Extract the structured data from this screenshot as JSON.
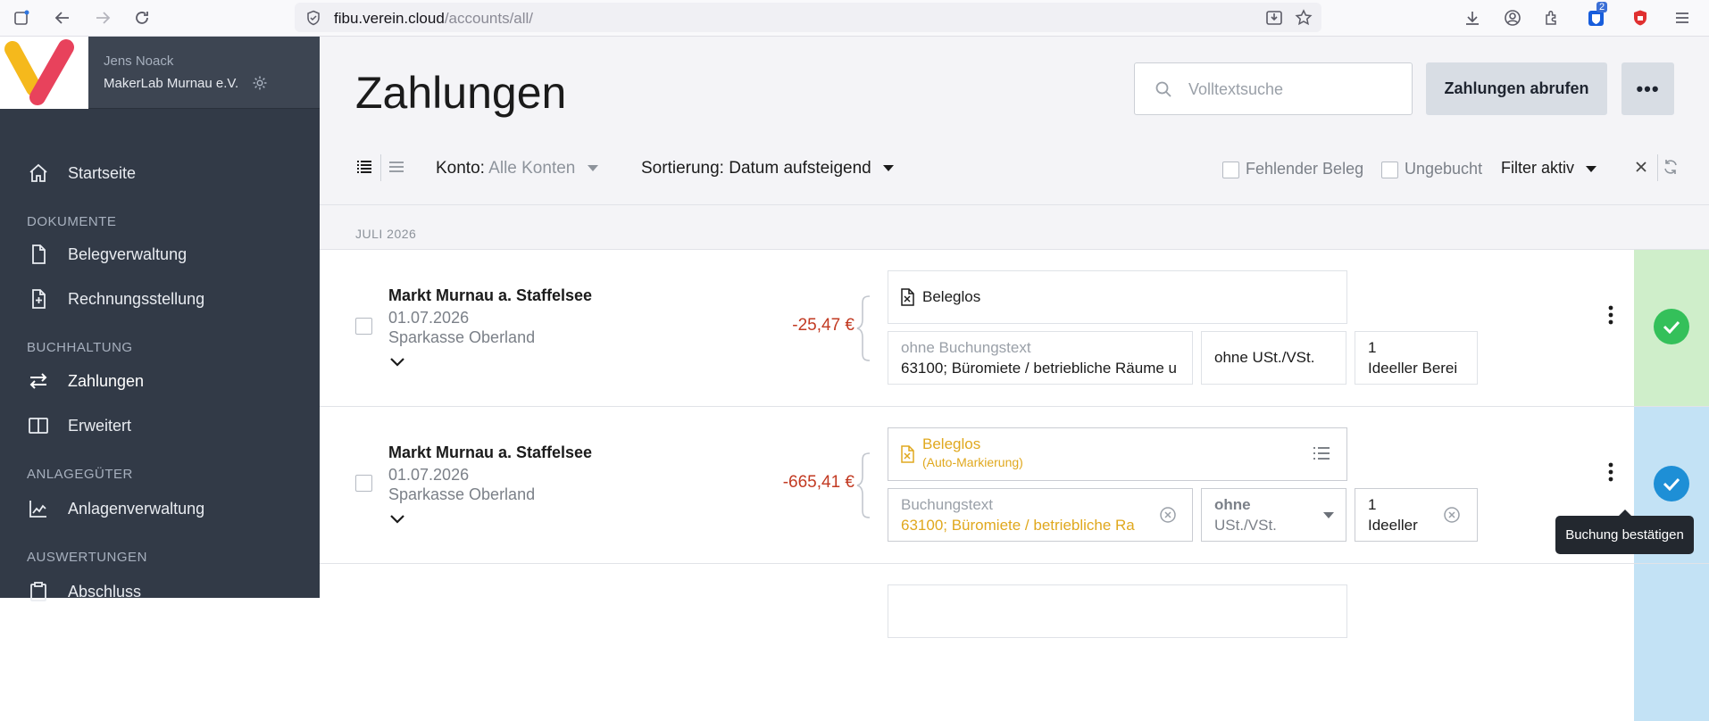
{
  "browser": {
    "url_host": "fibu.verein.cloud",
    "url_path": "/accounts/all/",
    "extension_badge": "2"
  },
  "sidebar": {
    "user_name": "Jens Noack",
    "org_name": "MakerLab Murnau e.V.",
    "sections": {
      "dokumente": "DOKUMENTE",
      "buchhaltung": "BUCHHALTUNG",
      "anlagegueter": "ANLAGEGÜTER",
      "auswertungen": "AUSWERTUNGEN"
    },
    "items": {
      "startseite": "Startseite",
      "belegverwaltung": "Belegverwaltung",
      "rechnungsstellung": "Rechnungsstellung",
      "zahlungen": "Zahlungen",
      "erweitert": "Erweitert",
      "anlagenverwaltung": "Anlagenverwaltung",
      "abschluss": "Abschluss"
    }
  },
  "header": {
    "title": "Zahlungen",
    "search_placeholder": "Volltextsuche",
    "fetch_button": "Zahlungen abrufen",
    "more_button": "•••"
  },
  "toolbar": {
    "konto_label": "Konto:",
    "konto_value": "Alle Konten",
    "sort_label": "Sortierung:",
    "sort_value": "Datum aufsteigend",
    "filter_missing": "Fehlender Beleg",
    "filter_unbooked": "Ungebucht",
    "filter_active": "Filter aktiv"
  },
  "month": "JULI 2026",
  "rows": [
    {
      "payee": "Markt Murnau a. Staffelsee",
      "date": "01.07.2026",
      "bank": "Sparkasse Oberland",
      "amount": "-25,47 €",
      "beleg": "Beleglos",
      "text_placeholder": "ohne Buchungstext",
      "account": "63100; Büromiete / betriebliche Räume u",
      "tax": "ohne USt./VSt.",
      "area_num": "1",
      "area_name": "Ideeller Berei",
      "status_color": "#cfeeca"
    },
    {
      "payee": "Markt Murnau a. Staffelsee",
      "date": "01.07.2026",
      "bank": "Sparkasse Oberland",
      "amount": "-665,41 €",
      "beleg": "Beleglos",
      "beleg_note": "(Auto-Markierung)",
      "text_placeholder": "Buchungstext",
      "account": "63100; Büromiete / betriebliche Ra",
      "tax_line1": "ohne",
      "tax_line2": "USt./VSt.",
      "area_num": "1",
      "area_name": "Ideeller",
      "status_color": "#c3e2f5"
    }
  ],
  "tooltip": "Buchung bestätigen",
  "colors": {
    "sidebar": "#323a47",
    "amount_negative": "#c23a22",
    "auto_mark": "#e0a81e",
    "confirmed_green": "#34c05a",
    "pending_blue": "#1e8fd6"
  }
}
